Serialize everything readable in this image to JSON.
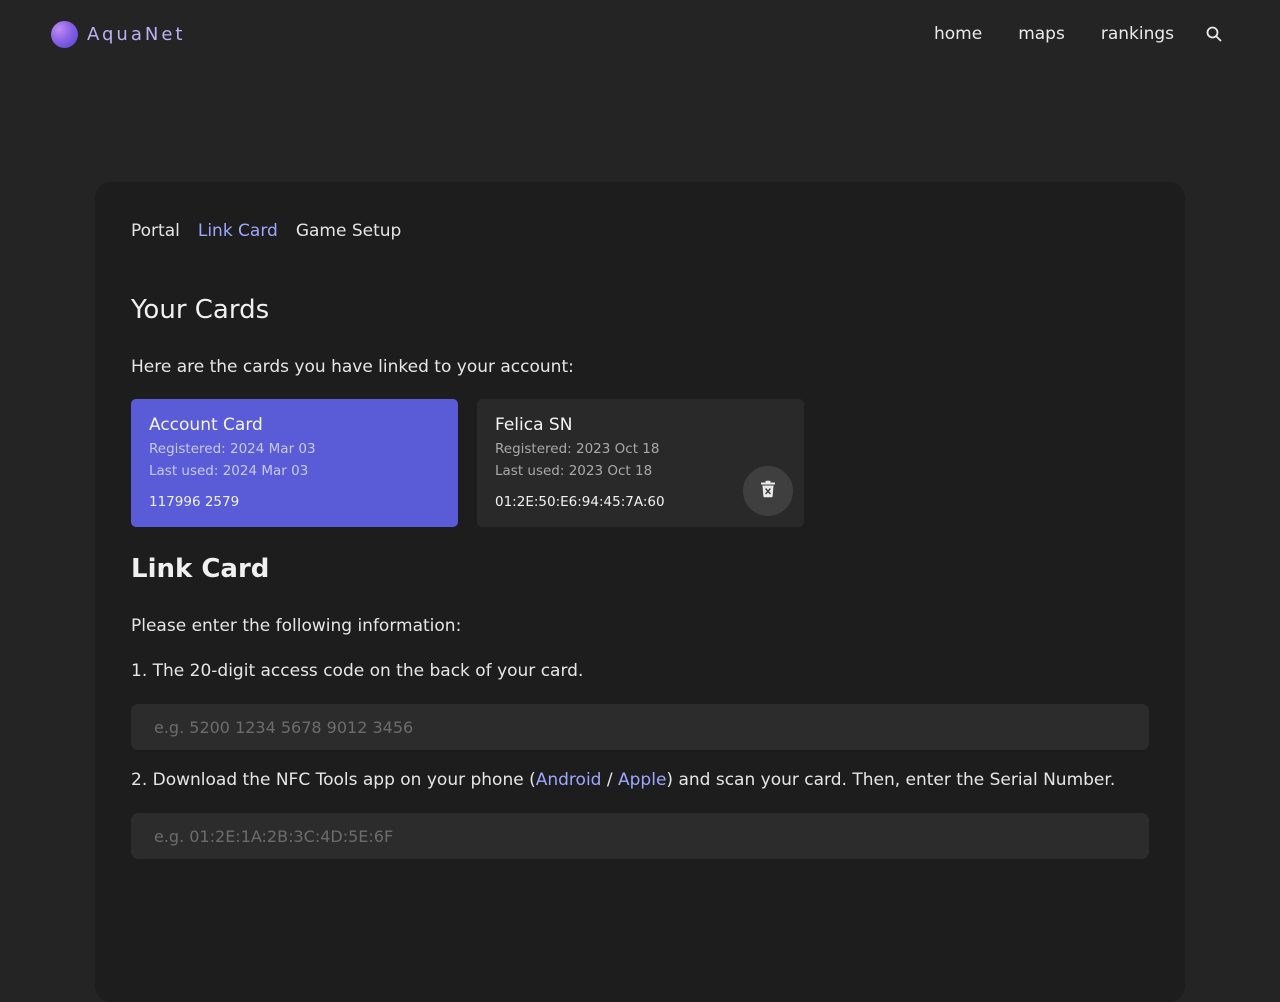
{
  "brand": {
    "name": "AquaNet"
  },
  "nav": {
    "items": [
      "home",
      "maps",
      "rankings"
    ]
  },
  "tabs": [
    {
      "label": "Portal",
      "active": false
    },
    {
      "label": "Link Card",
      "active": true
    },
    {
      "label": "Game Setup",
      "active": false
    }
  ],
  "cards_section": {
    "title": "Your Cards",
    "description": "Here are the cards you have linked to your account:",
    "cards": [
      {
        "title": "Account Card",
        "registered": "Registered: 2024 Mar 03",
        "last_used": "Last used: 2024 Mar 03",
        "id": "117996 2579"
      },
      {
        "title": "Felica SN",
        "registered": "Registered: 2023 Oct 18",
        "last_used": "Last used: 2023 Oct 18",
        "id": "01:2E:50:E6:94:45:7A:60"
      }
    ]
  },
  "link_section": {
    "title": "Link Card",
    "intro": "Please enter the following information:",
    "step1": "1. The 20-digit access code on the back of your card.",
    "step1_placeholder": "e.g. 5200 1234 5678 9012 3456",
    "step2_prefix": "2. Download the NFC Tools app on your phone (",
    "step2_android": "Android",
    "step2_sep": " / ",
    "step2_apple": "Apple",
    "step2_suffix": ") and scan your card. Then, enter the Serial Number.",
    "step2_placeholder": "e.g. 01:2E:1A:2B:3C:4D:5E:6F"
  },
  "colors": {
    "accent": "#9ea7ff",
    "account_card": "#5a5bd6",
    "background": "#242424",
    "panel": "#1d1d1d"
  },
  "icons": {
    "search": "search-icon",
    "delete": "trash-icon",
    "logo": "logo-icon"
  }
}
